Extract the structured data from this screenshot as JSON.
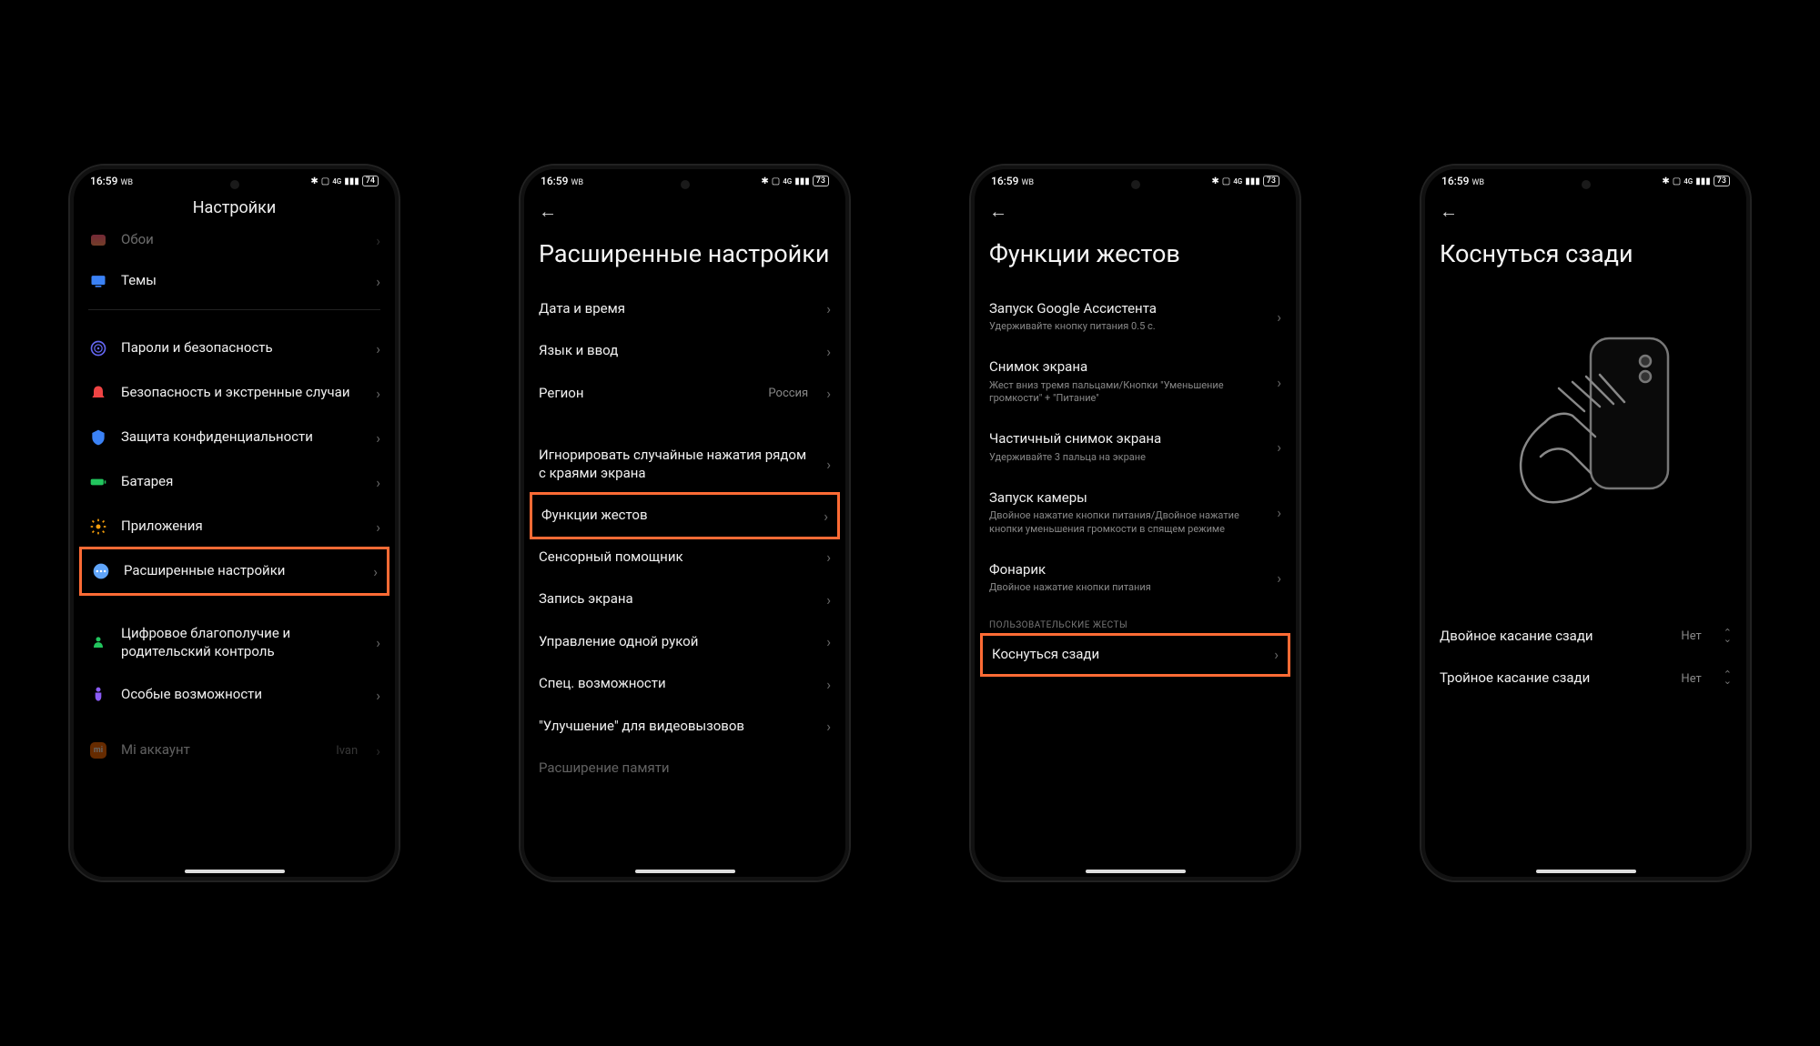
{
  "status": {
    "time": "16:59",
    "wb": "WB",
    "icons": "✱ ⬚ 4G ▯▮▮  74",
    "battery_1": "74",
    "battery_2": "73"
  },
  "phone1": {
    "title": "Настройки",
    "cutoff_item": "Обои",
    "items": [
      {
        "label": "Темы"
      },
      {
        "label": "Пароли и безопасность"
      },
      {
        "label": "Безопасность и экстренные случаи"
      },
      {
        "label": "Защита конфиденциальности"
      },
      {
        "label": "Батарея"
      },
      {
        "label": "Приложения"
      },
      {
        "label": "Расширенные настройки"
      },
      {
        "label": "Цифровое благополучие и родительский контроль"
      },
      {
        "label": "Особые возможности"
      },
      {
        "label": "Mi аккаунт",
        "value": "Ivan"
      }
    ]
  },
  "phone2": {
    "title": "Расширенные настройки",
    "items": [
      {
        "label": "Дата и время"
      },
      {
        "label": "Язык и ввод"
      },
      {
        "label": "Регион",
        "value": "Россия"
      },
      {
        "label": "Игнорировать случайные нажатия рядом с краями экрана"
      },
      {
        "label": "Функции жестов"
      },
      {
        "label": "Сенсорный помощник"
      },
      {
        "label": "Запись экрана"
      },
      {
        "label": "Управление одной рукой"
      },
      {
        "label": "Спец. возможности"
      },
      {
        "label": "\"Улучшение\" для видеовызовов"
      },
      {
        "label_cut": "Расширение памяти"
      }
    ]
  },
  "phone3": {
    "title": "Функции жестов",
    "items": [
      {
        "label": "Запуск Google Ассистента",
        "sub": "Удерживайте кнопку питания 0.5 с."
      },
      {
        "label": "Снимок экрана",
        "sub": "Жест вниз тремя пальцами/Кнопки \"Уменьшение громкости\" + \"Питание\""
      },
      {
        "label": "Частичный снимок экрана",
        "sub": "Удерживайте 3 пальца на экране"
      },
      {
        "label": "Запуск камеры",
        "sub": "Двойное нажатие кнопки питания/Двойное нажатие кнопки уменьшения громкости в спящем режиме"
      },
      {
        "label": "Фонарик",
        "sub": "Двойное нажатие кнопки питания"
      }
    ],
    "section": "ПОЛЬЗОВАТЕЛЬСКИЕ ЖЕСТЫ",
    "user_item": {
      "label": "Коснуться сзади"
    }
  },
  "phone4": {
    "title": "Коснуться сзади",
    "items": [
      {
        "label": "Двойное касание сзади",
        "value": "Нет"
      },
      {
        "label": "Тройное касание сзади",
        "value": "Нет"
      }
    ]
  }
}
